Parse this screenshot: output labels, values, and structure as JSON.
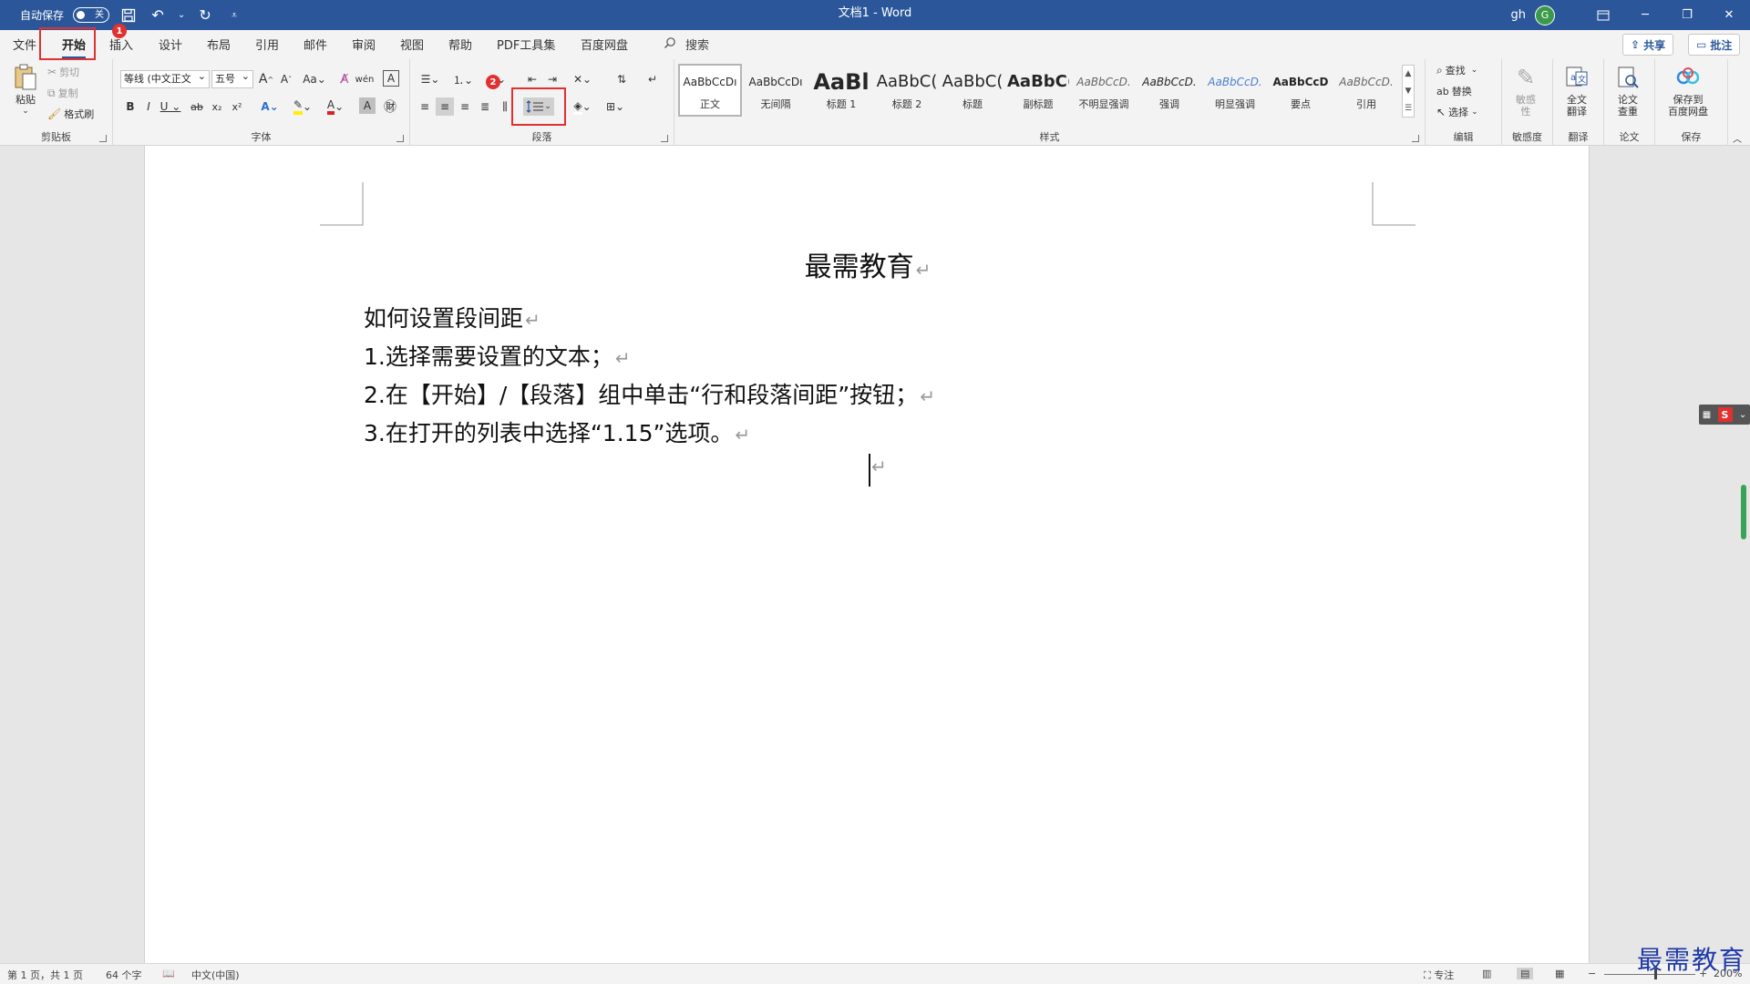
{
  "titlebar": {
    "autosave_label": "自动保存",
    "autosave_state": "关",
    "doc_title": "文档1  -  Word",
    "user_name": "gh",
    "avatar_initial": "G"
  },
  "tabs": {
    "file": "文件",
    "home": "开始",
    "insert": "插入",
    "design": "设计",
    "layout": "布局",
    "references": "引用",
    "mailings": "邮件",
    "review": "审阅",
    "view": "视图",
    "help": "帮助",
    "pdf": "PDF工具集",
    "baidu": "百度网盘",
    "search": "搜索",
    "share": "共享",
    "comments": "批注"
  },
  "ribbon": {
    "clipboard": {
      "paste": "粘贴",
      "cut": "剪切",
      "copy": "复制",
      "format_painter": "格式刷",
      "label": "剪贴板"
    },
    "font": {
      "font_name": "等线 (中文正文",
      "font_size": "五号",
      "label": "字体"
    },
    "paragraph": {
      "label": "段落"
    },
    "styles": {
      "label": "样式",
      "items": [
        {
          "sample": "AaBbCcDı",
          "name": "正文"
        },
        {
          "sample": "AaBbCcDı",
          "name": "无间隔"
        },
        {
          "sample": "AaBl",
          "name": "标题 1"
        },
        {
          "sample": "AaBbC(",
          "name": "标题 2"
        },
        {
          "sample": "AaBbC(",
          "name": "标题"
        },
        {
          "sample": "AaBbC(",
          "name": "副标题"
        },
        {
          "sample": "AaBbCcD.",
          "name": "不明显强调"
        },
        {
          "sample": "AaBbCcD.",
          "name": "强调"
        },
        {
          "sample": "AaBbCcD.",
          "name": "明显强调"
        },
        {
          "sample": "AaBbCcD",
          "name": "要点"
        },
        {
          "sample": "AaBbCcD.",
          "name": "引用"
        }
      ]
    },
    "editing": {
      "find": "查找",
      "replace": "替换",
      "select": "选择",
      "label": "编辑"
    },
    "sensitivity": {
      "btn": "敏感\n性",
      "label": "敏感度"
    },
    "translate": {
      "btn": "全文\n翻译",
      "label": "翻译"
    },
    "paper": {
      "btn": "论文\n查重",
      "label": "论文"
    },
    "save": {
      "btn": "保存到\n百度网盘",
      "label": "保存"
    }
  },
  "annotations": {
    "badge1": "1",
    "badge2": "2"
  },
  "document": {
    "heading": "最需教育",
    "lines": [
      "如何设置段间距",
      "1.选择需要设置的文本；",
      "2.在【开始】/【段落】组中单击“行和段落间距”按钮；",
      "3.在打开的列表中选择“1.15”选项。"
    ],
    "para_mark": "↵"
  },
  "statusbar": {
    "page": "第 1 页，共 1 页",
    "words": "64 个字",
    "language": "中文(中国)",
    "focus": "专注",
    "zoom": "200%"
  },
  "watermark": "最需教育"
}
